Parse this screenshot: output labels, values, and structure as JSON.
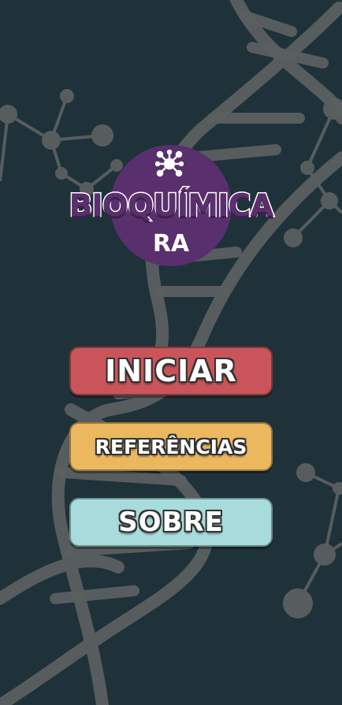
{
  "app": {
    "title": "BIOQUÍMICA",
    "subtitle": "RA"
  },
  "menu": {
    "start_label": "INICIAR",
    "references_label": "REFERÊNCIAS",
    "about_label": "SOBRE"
  },
  "colors": {
    "background": "#1f3239",
    "logo_purple": "#5a2f6e",
    "start_button": "#c9555b",
    "references_button": "#ebb85f",
    "about_button": "#a8dcdc"
  },
  "icons": {
    "logo": "molecule-icon",
    "background_dna": "dna-helix",
    "background_molecules": "molecule-network"
  }
}
